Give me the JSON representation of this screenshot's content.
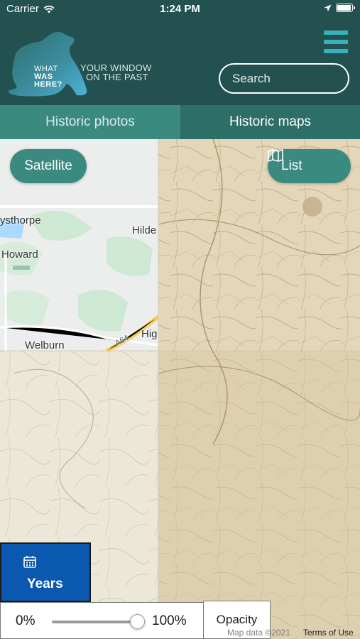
{
  "status": {
    "carrier": "Carrier",
    "time": "1:24 PM",
    "battery_level": 0.95
  },
  "header": {
    "logo": {
      "line1": "WHAT",
      "line2": "WAS",
      "line3": "HERE?"
    },
    "tagline": {
      "line1": "YOUR WINDOW",
      "line2": "ON THE PAST"
    },
    "search_placeholder": "Search"
  },
  "tabs": [
    {
      "label": "Historic photos",
      "active": false
    },
    {
      "label": "Historic maps",
      "active": true
    }
  ],
  "map": {
    "satellite_label": "Satellite",
    "list_label": "List",
    "places": [
      "ysthorpe",
      "Hilde",
      "Howard",
      "Welburn",
      "Hig"
    ],
    "road": "A64",
    "years_label": "Years",
    "opacity": {
      "min_label": "0%",
      "max_label": "100%",
      "value": 1.0,
      "button_label": "Opacity"
    },
    "attribution": "Map data ©2021",
    "terms": "Terms of Use"
  },
  "colors": {
    "header": "#23514f",
    "accent_teal": "#3b8a80",
    "menu": "#35b3bd",
    "years_blue": "#0b58b0"
  }
}
